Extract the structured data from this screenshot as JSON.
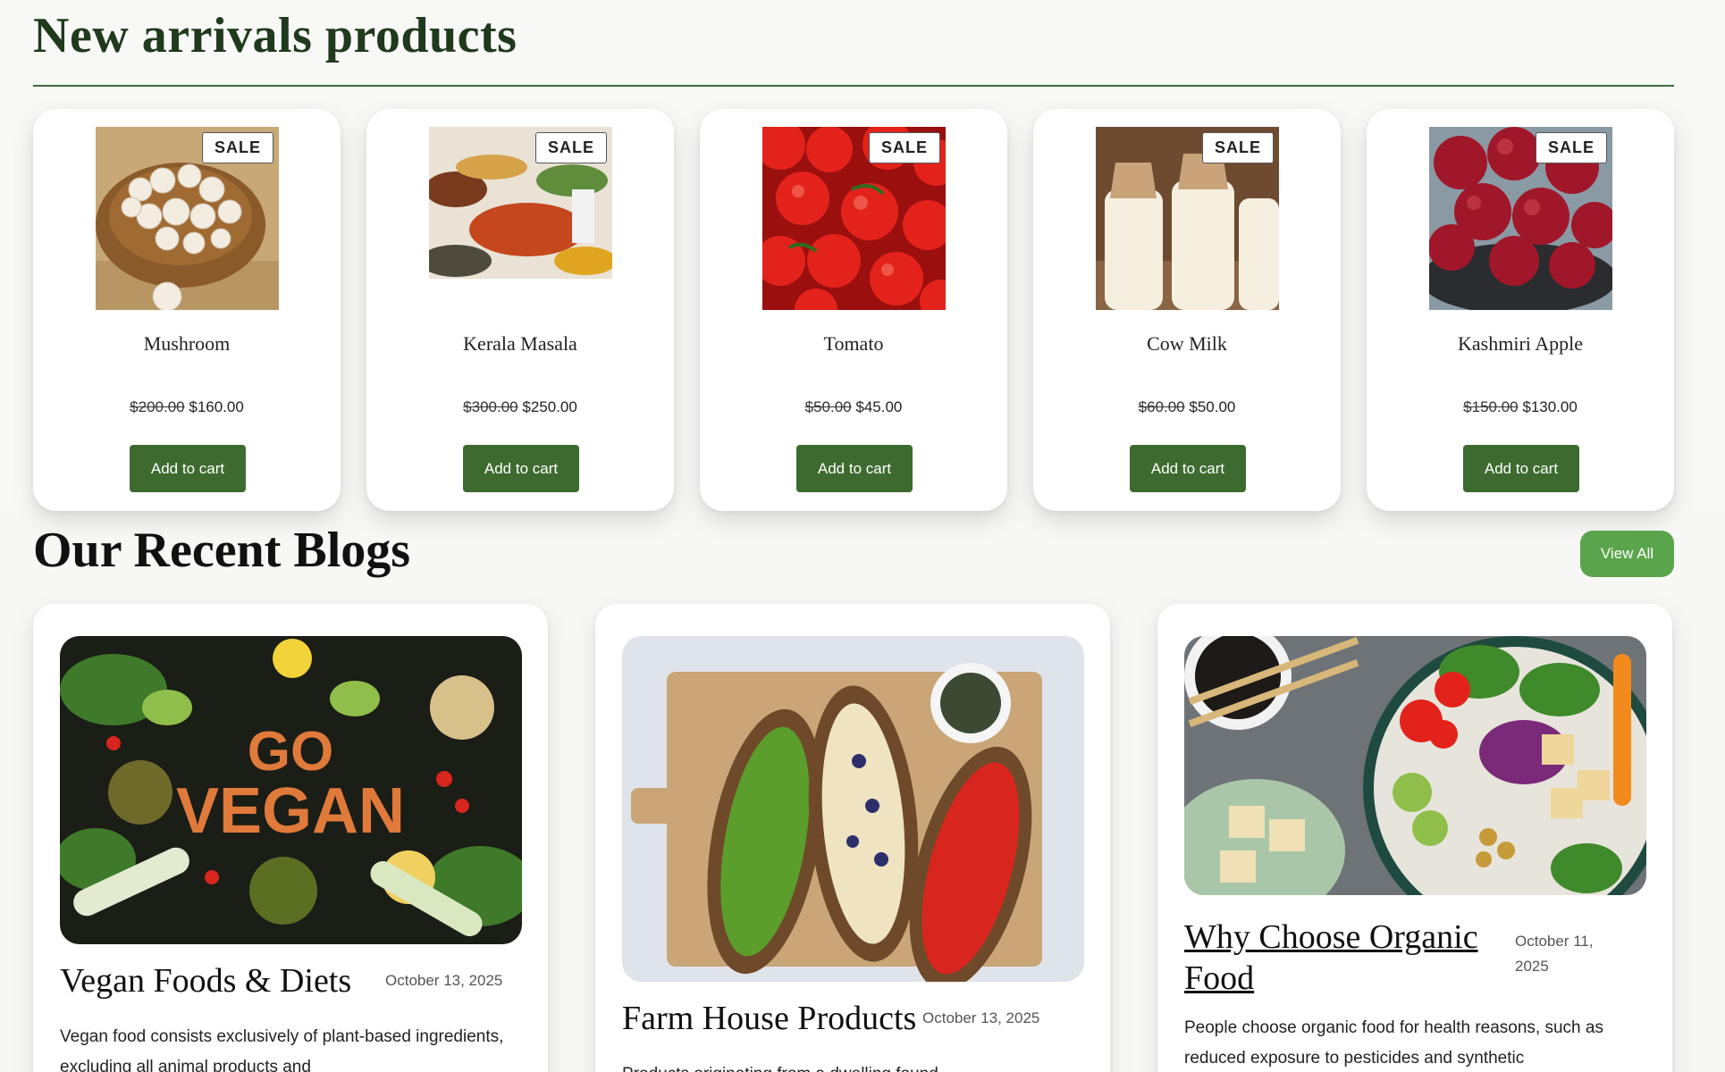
{
  "arrivals": {
    "heading": "New arrivals products",
    "products": [
      {
        "name": "Mushroom",
        "old_price": "$200.00",
        "price": "$160.00",
        "badge": "SALE",
        "button": "Add to cart"
      },
      {
        "name": "Kerala Masala",
        "old_price": "$300.00",
        "price": "$250.00",
        "badge": "SALE",
        "button": "Add to cart"
      },
      {
        "name": "Tomato",
        "old_price": "$50.00",
        "price": "$45.00",
        "badge": "SALE",
        "button": "Add to cart"
      },
      {
        "name": "Cow Milk",
        "old_price": "$60.00",
        "price": "$50.00",
        "badge": "SALE",
        "button": "Add to cart"
      },
      {
        "name": "Kashmiri Apple",
        "old_price": "$150.00",
        "price": "$130.00",
        "badge": "SALE",
        "button": "Add to cart"
      }
    ]
  },
  "blogs": {
    "heading": "Our Recent Blogs",
    "view_all": "View All",
    "posts": [
      {
        "title": "Vegan Foods & Diets",
        "date": "October 13, 2025",
        "excerpt": "Vegan food consists exclusively of plant-based ingredients, excluding all animal products and"
      },
      {
        "title": "Farm House Products",
        "date": "October 13, 2025",
        "excerpt": "Products originating from a dwelling found"
      },
      {
        "title": "Why Choose Organic Food",
        "date": "October 11, 2025",
        "excerpt": "People choose organic food for health reasons, such as reduced exposure to pesticides and synthetic"
      }
    ]
  },
  "colors": {
    "brand_green": "#3d6b2f",
    "view_all_green": "#5aa54b",
    "heading_green": "#1f3a1c"
  }
}
